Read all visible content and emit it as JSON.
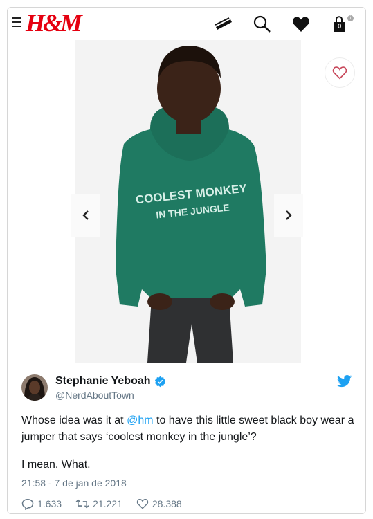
{
  "hm": {
    "logo_text": "H&M",
    "bag_count": "0",
    "info_badge": "i",
    "icons": [
      "menu-icon",
      "hanger-icon",
      "search-icon",
      "heart-icon",
      "shopping-bag-icon"
    ]
  },
  "product": {
    "hoodie_text_line1": "COOLEST MONKEY",
    "hoodie_text_line2": "IN THE JUNGLE",
    "hoodie_color": "#1f7a62"
  },
  "tweet": {
    "display_name": "Stephanie Yeboah",
    "handle": "@NerdAboutTown",
    "text_before_mention": "Whose idea was it at ",
    "mention": "@hm",
    "text_after_mention": " to have this little sweet black boy wear a jumper that says ‘coolest monkey in the jungle’?",
    "text_line2": "I mean. What.",
    "timestamp": "21:58 - 7 de jan de 2018",
    "replies": "1.633",
    "retweets": "21.221",
    "likes": "28.388"
  },
  "colors": {
    "hm_red": "#e50010",
    "twitter_blue": "#1da1f2",
    "muted_gray": "#657786"
  }
}
